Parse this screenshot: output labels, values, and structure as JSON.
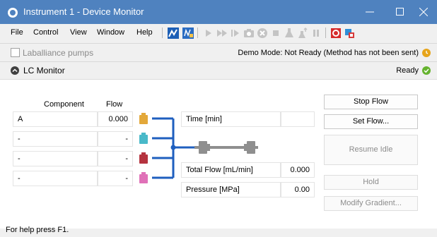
{
  "window": {
    "title": "Instrument 1 - Device Monitor",
    "titlebar_color": "#4f82bf"
  },
  "menu": {
    "items": [
      "File",
      "Control",
      "View",
      "Window",
      "Help"
    ],
    "toolbar_icons": [
      "bar-chart-icon",
      "instrument-chart-icon",
      "play-icon",
      "fast-forward-icon",
      "step-forward-icon",
      "camera-icon",
      "stop-circle-icon",
      "stop-square-icon",
      "flask-icon",
      "flask-up-icon",
      "pause-icon",
      "record-icon",
      "network-icon"
    ]
  },
  "pumps": {
    "label": "Laballiance pumps",
    "checked": false,
    "demo_status": "Demo Mode: Not Ready (Method has not been sent)",
    "demo_icon": "clock-warning-icon",
    "demo_color": "#e7a51b"
  },
  "lc_monitor": {
    "title": "LC Monitor",
    "status": "Ready",
    "status_color": "#65b32e"
  },
  "table": {
    "headers": {
      "component": "Component",
      "flow": "Flow"
    },
    "rows": [
      {
        "component": "A",
        "flow": "0.000",
        "bottle_color": "#e3a83a"
      },
      {
        "component": "-",
        "flow": "-",
        "bottle_color": "#49b9c9"
      },
      {
        "component": "-",
        "flow": "-",
        "bottle_color": "#b5333f"
      },
      {
        "component": "-",
        "flow": "-",
        "bottle_color": "#e071b8"
      }
    ]
  },
  "readouts": {
    "time_label": "Time [min]",
    "time_value": "",
    "total_flow_label": "Total Flow [mL/min]",
    "total_flow_value": "0.000",
    "pressure_label": "Pressure [MPa]",
    "pressure_value": "0.00"
  },
  "buttons": {
    "stop_flow": "Stop Flow",
    "set_flow": "Set Flow...",
    "resume_idle": "Resume Idle",
    "hold": "Hold",
    "modify_gradient": "Modify Gradient..."
  },
  "statusbar": {
    "text": "For help press F1."
  },
  "colors": {
    "flow_line": "#1f5fbf",
    "column": "#8f8f8f"
  }
}
